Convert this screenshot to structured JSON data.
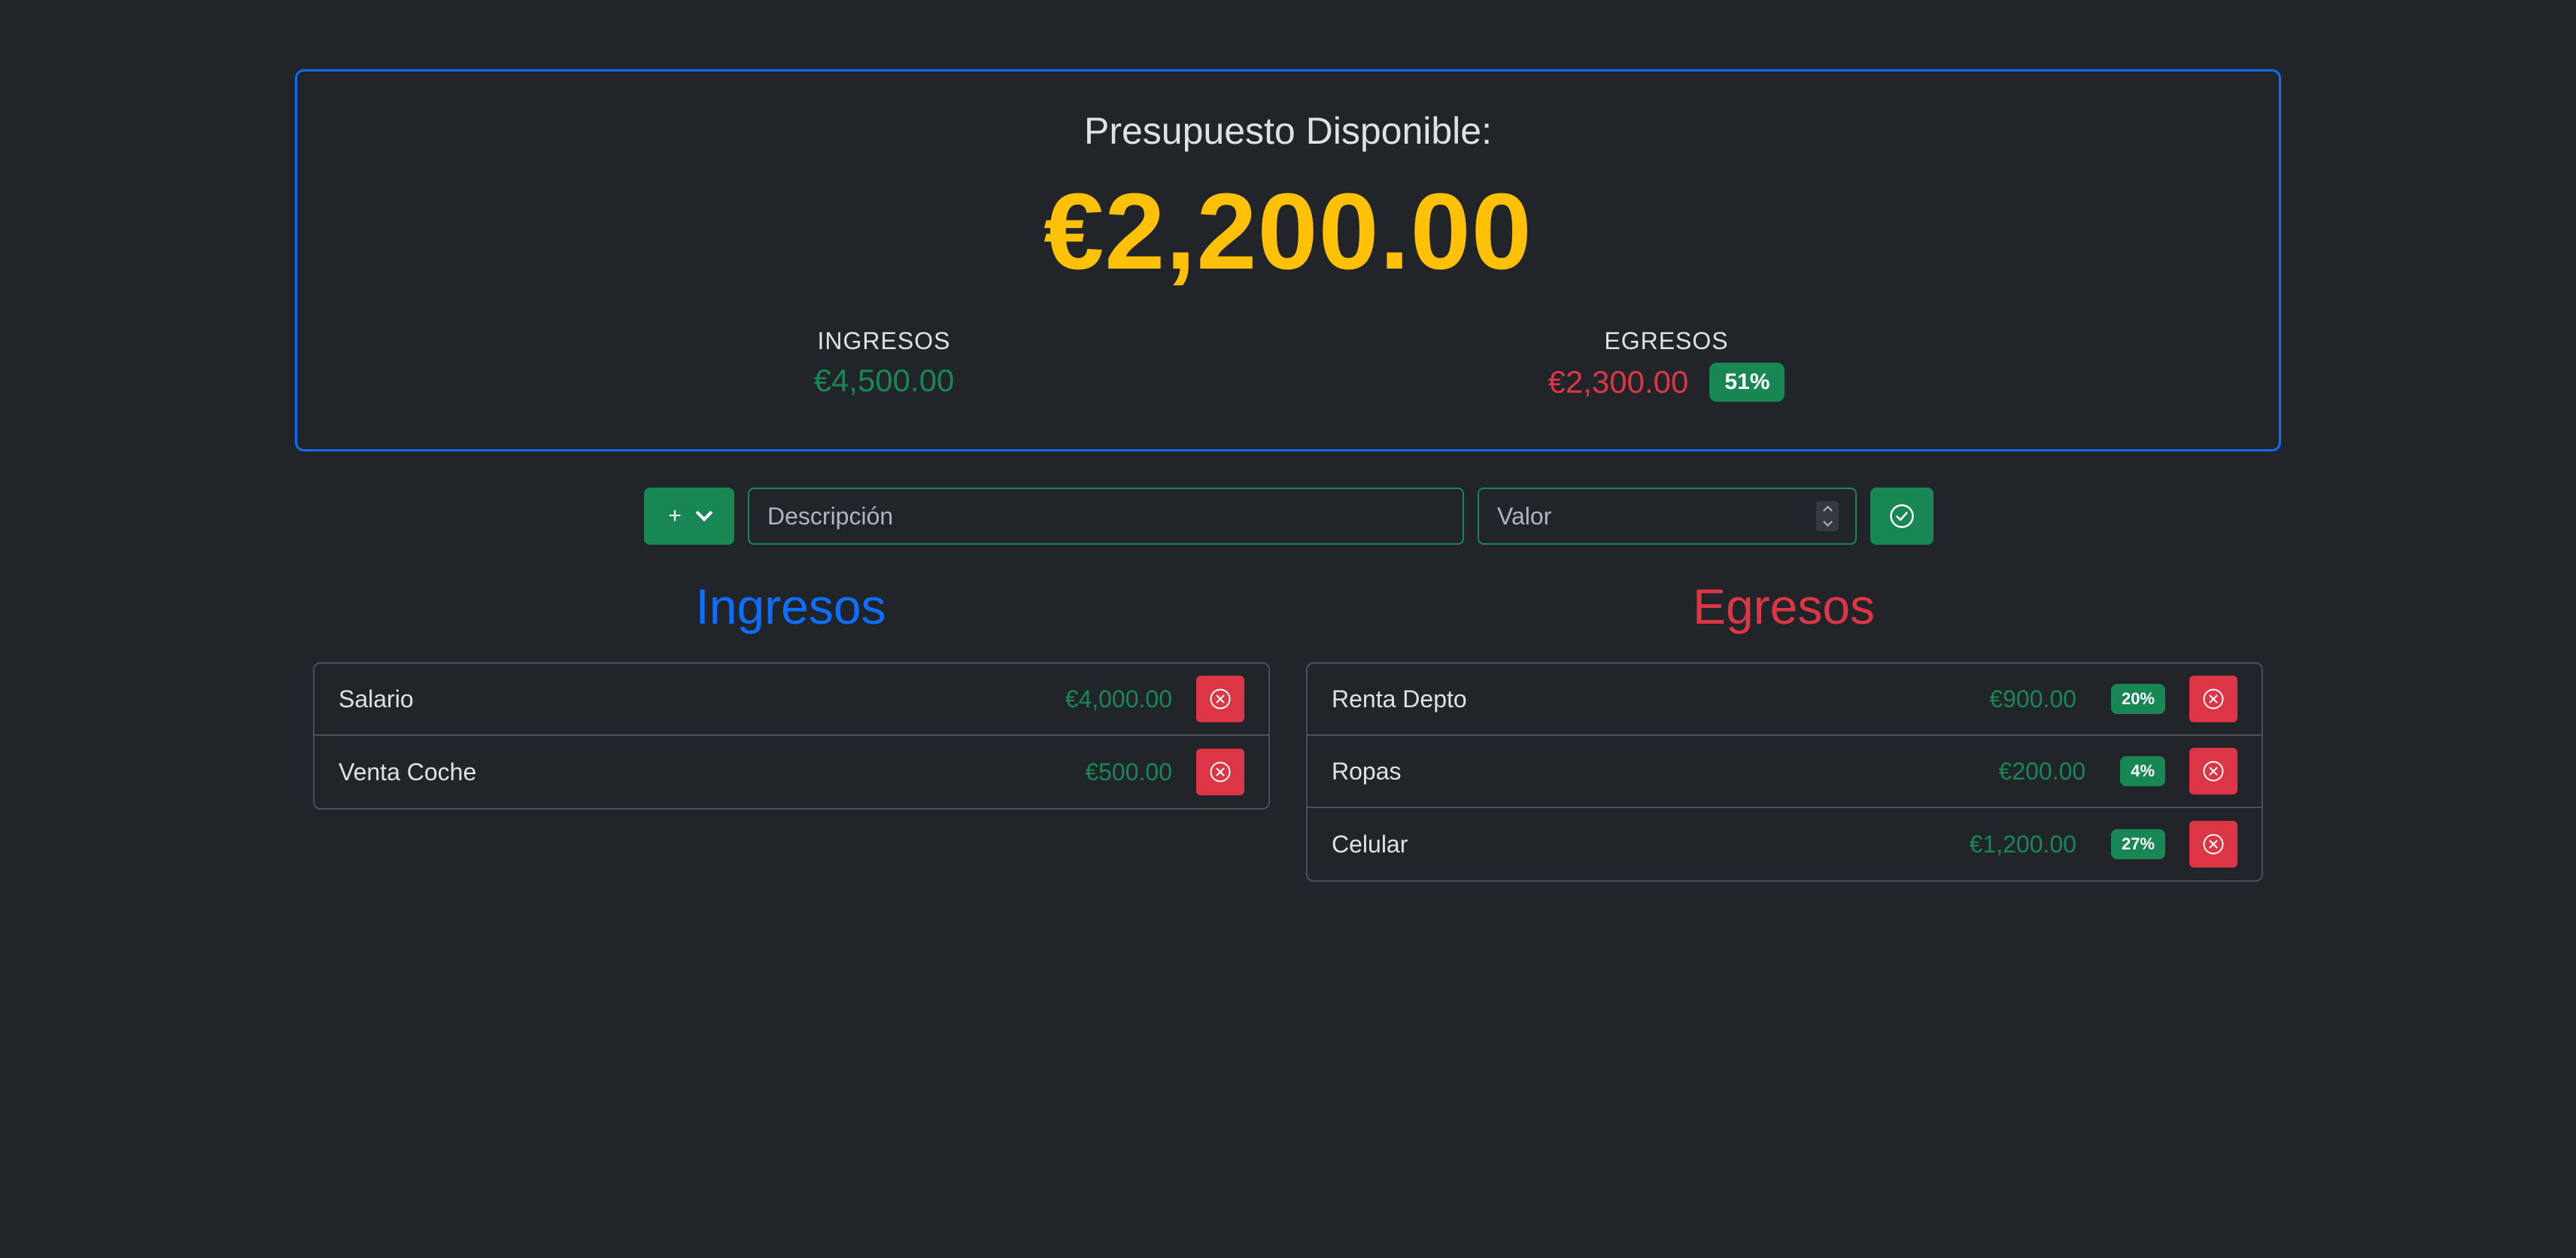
{
  "budget": {
    "title": "Presupuesto Disponible:",
    "total": "€2,200.00",
    "ingresos_label": "INGRESOS",
    "ingresos_total": "€4,500.00",
    "egresos_label": "EGRESOS",
    "egresos_total": "€2,300.00",
    "egresos_pct": "51%"
  },
  "form": {
    "type_symbol": "+",
    "type_icon": "chevron-down-icon",
    "description_placeholder": "Descripción",
    "value_placeholder": "Valor",
    "submit_icon": "check-circle-icon"
  },
  "ingresos": {
    "title": "Ingresos",
    "items": [
      {
        "description": "Salario",
        "value": "€4,000.00"
      },
      {
        "description": "Venta Coche",
        "value": "€500.00"
      }
    ]
  },
  "egresos": {
    "title": "Egresos",
    "items": [
      {
        "description": "Renta Depto",
        "value": "€900.00",
        "pct": "20%"
      },
      {
        "description": "Ropas",
        "value": "€200.00",
        "pct": "4%"
      },
      {
        "description": "Celular",
        "value": "€1,200.00",
        "pct": "27%"
      }
    ]
  },
  "colors": {
    "background": "#212529",
    "primary": "#0d6efd",
    "success": "#198754",
    "danger": "#dc3545",
    "warning": "#ffc107"
  }
}
